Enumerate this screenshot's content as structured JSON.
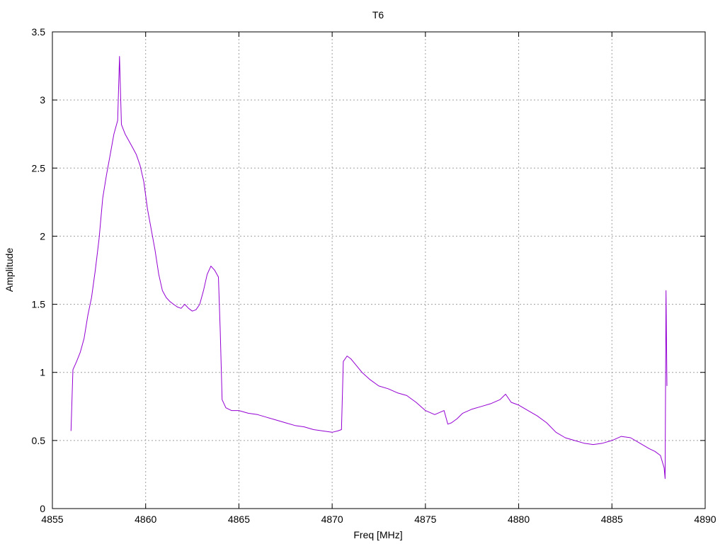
{
  "chart_data": {
    "type": "line",
    "title": "T6",
    "xlabel": "Freq [MHz]",
    "ylabel": "Amplitude",
    "xlim": [
      4855,
      4890
    ],
    "ylim": [
      0,
      3.5
    ],
    "xticks": [
      4855,
      4860,
      4865,
      4870,
      4875,
      4880,
      4885,
      4890
    ],
    "yticks": [
      0,
      0.5,
      1,
      1.5,
      2,
      2.5,
      3,
      3.5
    ],
    "ytick_labels": [
      "0",
      "0.5",
      "1",
      "1.5",
      "2",
      "2.5",
      "3",
      "3.5"
    ],
    "grid": true,
    "series": [
      {
        "color": "#9400d3",
        "x": [
          4856.0,
          4856.1,
          4856.3,
          4856.5,
          4856.7,
          4856.9,
          4857.1,
          4857.3,
          4857.5,
          4857.7,
          4857.9,
          4858.1,
          4858.3,
          4858.5,
          4858.6,
          4858.7,
          4858.9,
          4859.1,
          4859.3,
          4859.5,
          4859.7,
          4859.9,
          4860.1,
          4860.3,
          4860.5,
          4860.7,
          4860.9,
          4861.1,
          4861.3,
          4861.5,
          4861.7,
          4861.9,
          4862.1,
          4862.3,
          4862.5,
          4862.7,
          4862.9,
          4863.1,
          4863.3,
          4863.5,
          4863.7,
          4863.9,
          4864.0,
          4864.1,
          4864.3,
          4864.6,
          4865.0,
          4865.5,
          4866.0,
          4866.5,
          4867.0,
          4867.5,
          4868.0,
          4868.5,
          4869.0,
          4869.5,
          4870.0,
          4870.3,
          4870.5,
          4870.6,
          4870.8,
          4871.0,
          4871.3,
          4871.6,
          4872.0,
          4872.5,
          4873.0,
          4873.5,
          4874.0,
          4874.5,
          4875.0,
          4875.5,
          4876.0,
          4876.2,
          4876.4,
          4876.7,
          4877.0,
          4877.5,
          4878.0,
          4878.5,
          4879.0,
          4879.3,
          4879.6,
          4880.0,
          4880.5,
          4881.0,
          4881.5,
          4882.0,
          4882.5,
          4883.0,
          4883.5,
          4884.0,
          4884.5,
          4885.0,
          4885.5,
          4886.0,
          4886.5,
          4887.0,
          4887.3,
          4887.6,
          4887.8,
          4887.85,
          4887.9,
          4887.95
        ],
        "y": [
          0.57,
          1.02,
          1.08,
          1.15,
          1.25,
          1.42,
          1.55,
          1.75,
          1.98,
          2.28,
          2.45,
          2.6,
          2.75,
          2.85,
          3.32,
          2.82,
          2.75,
          2.7,
          2.65,
          2.6,
          2.52,
          2.4,
          2.2,
          2.05,
          1.9,
          1.72,
          1.6,
          1.55,
          1.52,
          1.5,
          1.48,
          1.47,
          1.5,
          1.47,
          1.45,
          1.46,
          1.5,
          1.6,
          1.72,
          1.78,
          1.75,
          1.7,
          1.3,
          0.8,
          0.74,
          0.72,
          0.72,
          0.7,
          0.69,
          0.67,
          0.65,
          0.63,
          0.61,
          0.6,
          0.58,
          0.57,
          0.56,
          0.57,
          0.58,
          1.08,
          1.12,
          1.1,
          1.05,
          1.0,
          0.95,
          0.9,
          0.88,
          0.85,
          0.83,
          0.78,
          0.72,
          0.69,
          0.72,
          0.62,
          0.63,
          0.66,
          0.7,
          0.73,
          0.75,
          0.77,
          0.8,
          0.84,
          0.78,
          0.76,
          0.72,
          0.68,
          0.63,
          0.56,
          0.52,
          0.5,
          0.48,
          0.47,
          0.48,
          0.5,
          0.53,
          0.52,
          0.48,
          0.44,
          0.42,
          0.39,
          0.3,
          0.22,
          1.6,
          0.9
        ]
      }
    ]
  }
}
